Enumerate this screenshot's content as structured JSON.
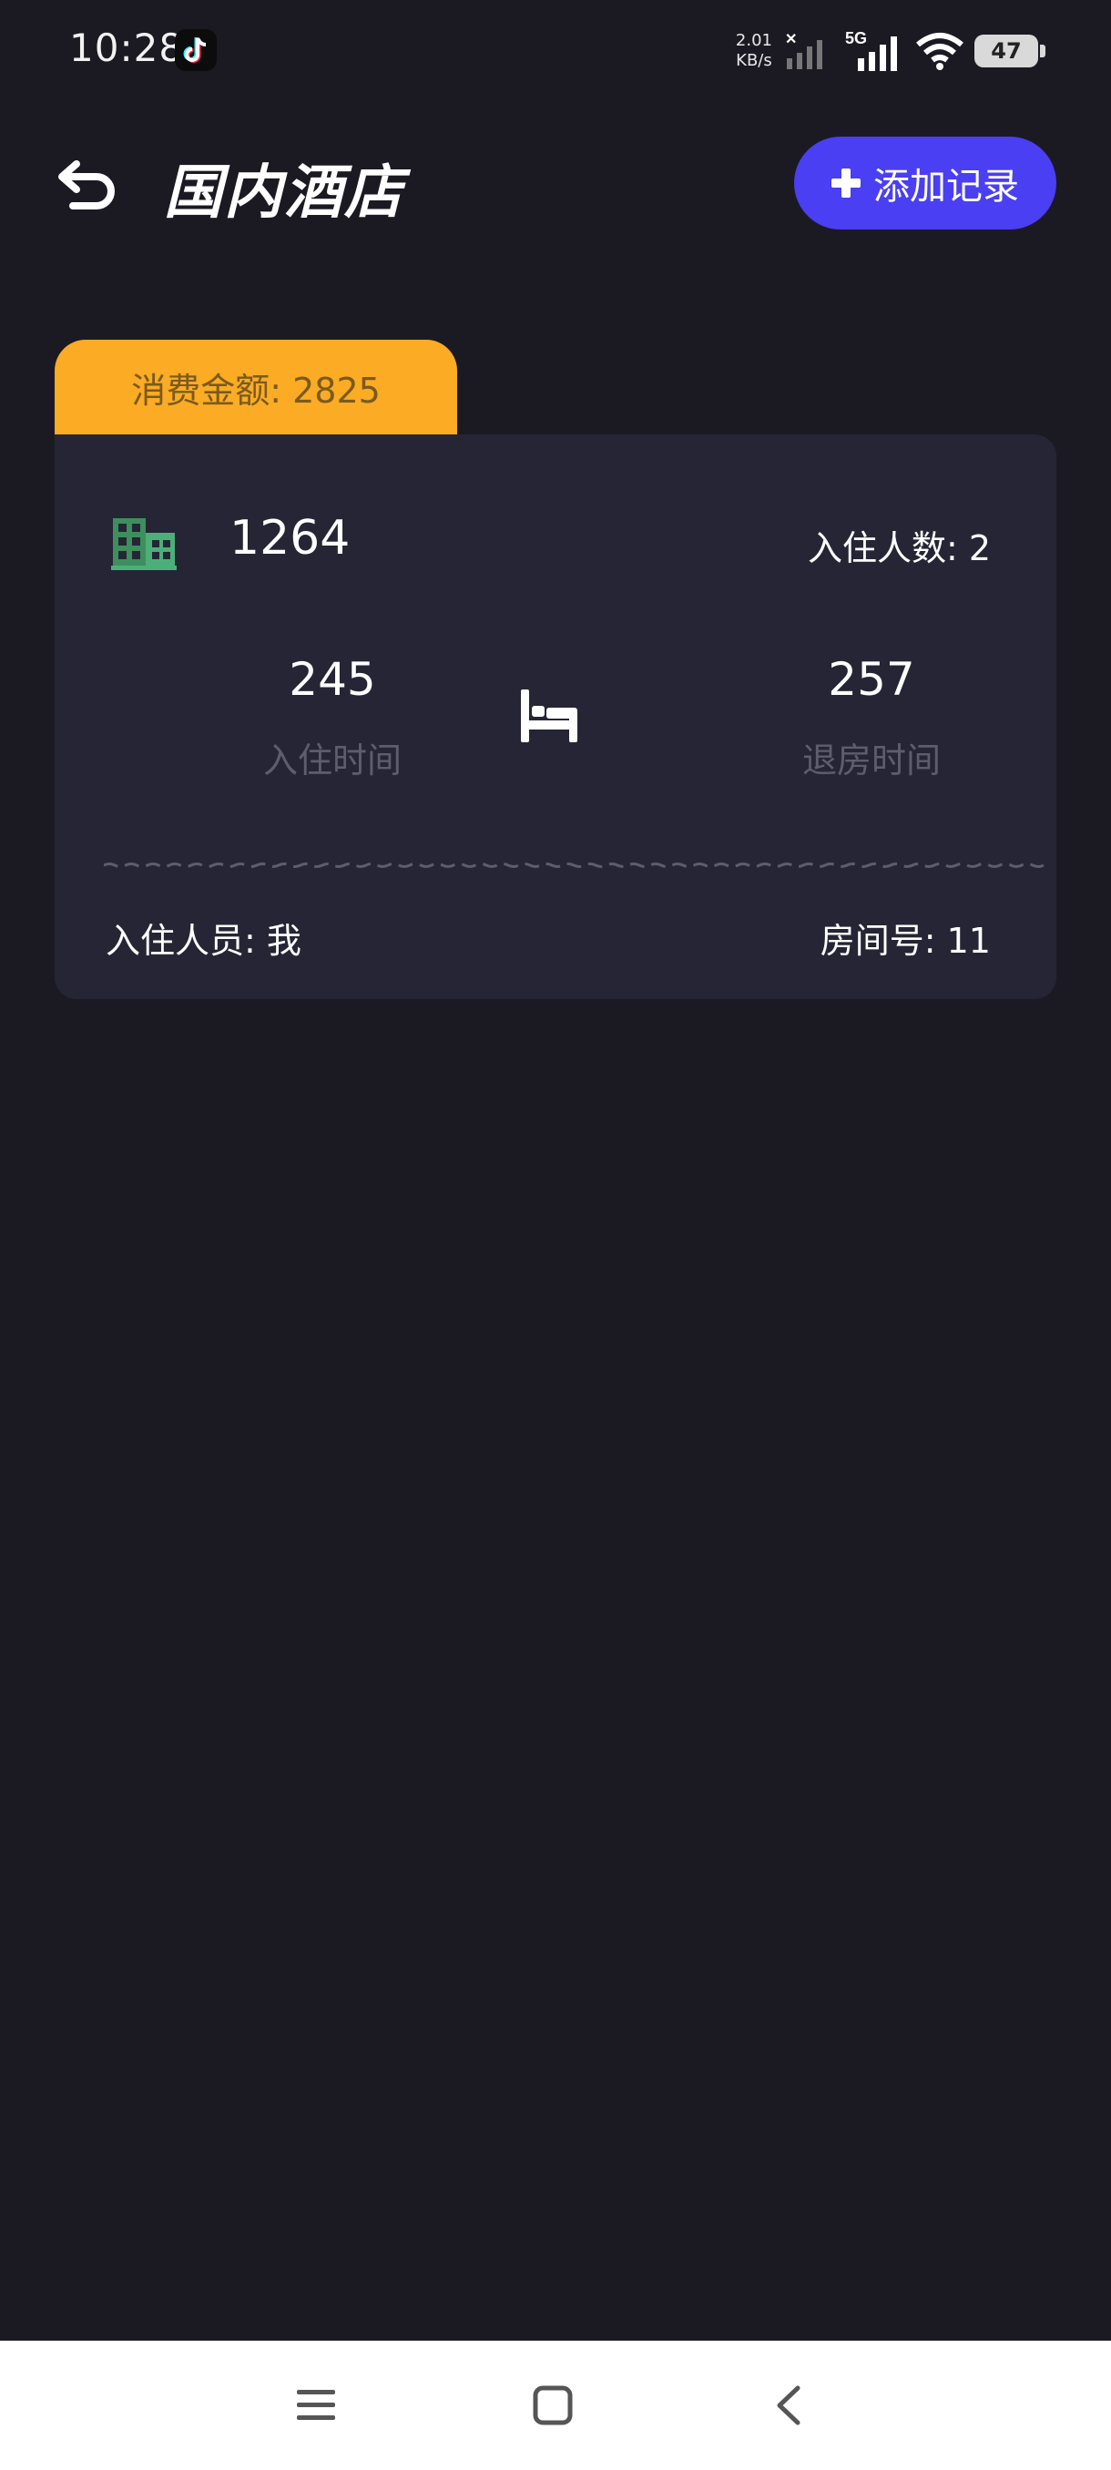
{
  "status_bar": {
    "time": "10:28",
    "net_speed_value": "2.01",
    "net_speed_unit": "KB/s",
    "network": "5G",
    "battery": "47"
  },
  "header": {
    "title": "国内酒店",
    "add_button_label": "添加记录"
  },
  "record": {
    "amount_label": "消费金额: 2825",
    "hotel_price": "1264",
    "guest_count_label": "入住人数: 2",
    "checkin_value": "245",
    "checkin_label": "入住时间",
    "checkout_value": "257",
    "checkout_label": "退房时间",
    "occupant_label": "入住人员: 我",
    "room_number_label": "房间号: 11"
  },
  "colors": {
    "background": "#1b1a23",
    "card": "#252535",
    "accent_orange": "#fbab24",
    "accent_blue": "#4a3ff2",
    "hotel_icon_green": "#4caf7a"
  },
  "icons": [
    "tiktok-icon",
    "signal-icon",
    "wifi-icon",
    "battery-icon",
    "back-arrow-icon",
    "plus-icon",
    "hotel-building-icon",
    "bed-icon",
    "menu-icon",
    "home-icon",
    "nav-back-icon"
  ]
}
